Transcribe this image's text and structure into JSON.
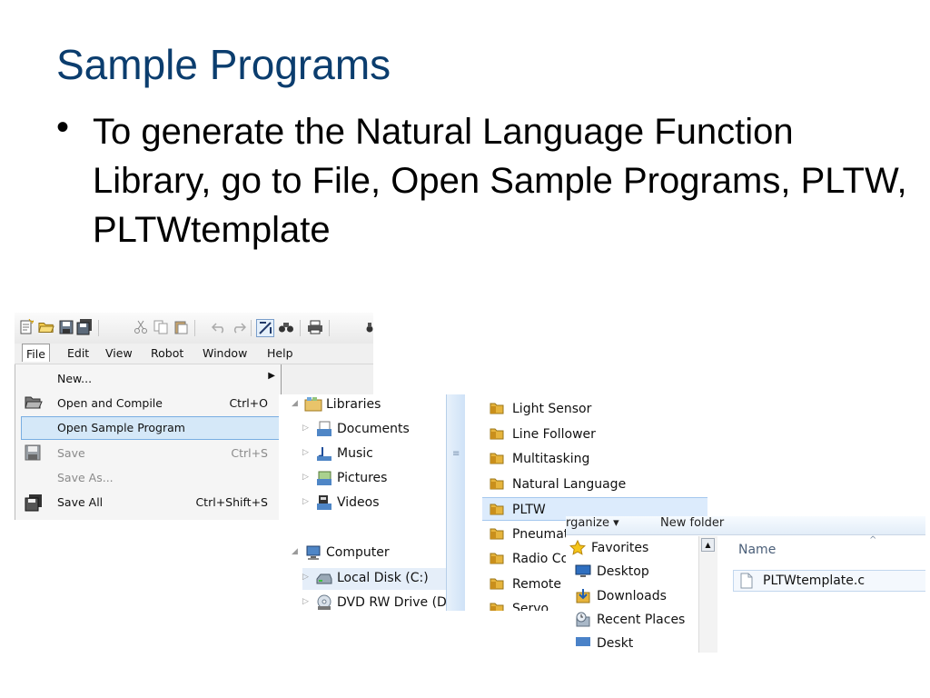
{
  "slide": {
    "title": "Sample Programs",
    "bullet_symbol": "•",
    "bullet_text": "To generate the Natural Language Function Library, go to File, Open Sample Programs, PLTW, PLTWtemplate"
  },
  "robotc_window": {
    "menubar": [
      "File",
      "Edit",
      "View",
      "Robot",
      "Window",
      "Help"
    ],
    "file_menu": {
      "items": [
        {
          "label": "New...",
          "shortcut": "",
          "submenu": true,
          "enabled": true,
          "highlighted": false,
          "icon": ""
        },
        {
          "label": "Open and Compile",
          "shortcut": "Ctrl+O",
          "submenu": false,
          "enabled": true,
          "highlighted": false,
          "icon": "open-folder-icon"
        },
        {
          "label": "Open Sample Program",
          "shortcut": "",
          "submenu": false,
          "enabled": true,
          "highlighted": true,
          "icon": ""
        },
        {
          "label": "Save",
          "shortcut": "Ctrl+S",
          "submenu": false,
          "enabled": false,
          "highlighted": false,
          "icon": "floppy-disk-icon"
        },
        {
          "label": "Save As...",
          "shortcut": "",
          "submenu": false,
          "enabled": false,
          "highlighted": false,
          "icon": ""
        },
        {
          "label": "Save All",
          "shortcut": "Ctrl+Shift+S",
          "submenu": false,
          "enabled": true,
          "highlighted": false,
          "icon": "save-all-icon"
        }
      ]
    },
    "toolbar_icons": [
      "new-file-icon",
      "open-folder-icon",
      "save-icon",
      "save-all-icon",
      "cut-icon",
      "copy-icon",
      "paste-icon",
      "undo-icon",
      "redo-icon",
      "compile-icon",
      "find-icon",
      "print-icon"
    ]
  },
  "nav_tree": {
    "items": [
      {
        "label": "Libraries",
        "icon": "libraries-icon",
        "expanded": true
      },
      {
        "label": "Documents",
        "icon": "documents-icon",
        "expanded": false
      },
      {
        "label": "Music",
        "icon": "music-icon",
        "expanded": false
      },
      {
        "label": "Pictures",
        "icon": "pictures-icon",
        "expanded": false
      },
      {
        "label": "Videos",
        "icon": "videos-icon",
        "expanded": false
      },
      {
        "label": "Computer",
        "icon": "computer-icon",
        "expanded": true
      },
      {
        "label": "Local Disk (C:)",
        "icon": "local-disk-icon",
        "expanded": false,
        "selected": true
      },
      {
        "label": "DVD RW Drive (D",
        "icon": "dvd-drive-icon",
        "expanded": false
      }
    ]
  },
  "folder_list": {
    "items": [
      {
        "label": "Light Sensor",
        "selected": false
      },
      {
        "label": "Line Follower",
        "selected": false
      },
      {
        "label": "Multitasking",
        "selected": false
      },
      {
        "label": "Natural Language",
        "selected": false
      },
      {
        "label": "PLTW",
        "selected": true
      },
      {
        "label": "Pneumati",
        "selected": false
      },
      {
        "label": "Radio Co",
        "selected": false
      },
      {
        "label": "Remote C",
        "selected": false
      },
      {
        "label": "Servo",
        "selected": false
      }
    ]
  },
  "file_dialog": {
    "toolbar": {
      "organize": "rganize ▾",
      "new_folder": "New folder"
    },
    "nav": [
      {
        "label": "Favorites",
        "icon": "favorites-star-icon"
      },
      {
        "label": "Desktop",
        "icon": "desktop-icon"
      },
      {
        "label": "Downloads",
        "icon": "downloads-icon"
      },
      {
        "label": "Recent Places",
        "icon": "recent-places-icon"
      },
      {
        "label": "Deskt",
        "icon": "desktop-icon"
      }
    ],
    "column_header": "Name",
    "files": [
      {
        "label": "PLTWtemplate.c",
        "icon": "c-file-icon"
      }
    ]
  },
  "colors": {
    "title": "#0b3d6e",
    "menu_highlight": "#d5e8f8",
    "folder_yellow": "#e6b43c"
  }
}
